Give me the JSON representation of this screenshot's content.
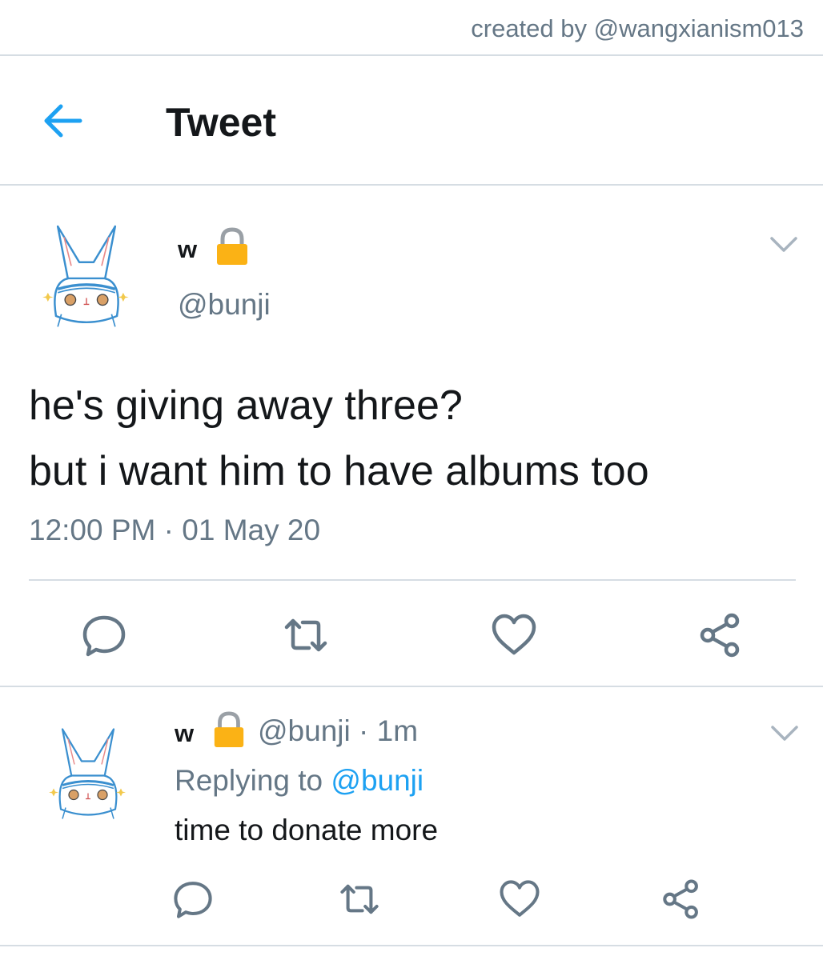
{
  "credit": "created by @wangxianism013",
  "header": {
    "title": "Tweet",
    "back_icon": "arrow-left-icon"
  },
  "main_tweet": {
    "name": "w",
    "handle": "@bunji",
    "lines": [
      "he's giving away three?",
      "but i want him to have albums too"
    ],
    "time": "12:00 PM",
    "dot": "·",
    "date": "01 May 20"
  },
  "reply": {
    "name": "w",
    "handle": "@bunji",
    "dot": "·",
    "age": "1m",
    "replying_prefix": "Replying to",
    "replying_to": "@bunji",
    "text": "time to donate more"
  },
  "icons": {
    "reply": "reply-icon",
    "retweet": "retweet-icon",
    "like": "heart-icon",
    "share": "share-icon",
    "lock": "lock-icon",
    "chevron": "chevron-down-icon"
  },
  "colors": {
    "accent": "#1da1f2",
    "muted": "#657786",
    "text": "#14171a",
    "divider": "#d6dde3",
    "lock": "#fbb215"
  }
}
